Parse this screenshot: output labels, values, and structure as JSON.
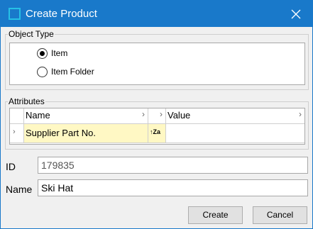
{
  "window": {
    "title": "Create Product"
  },
  "object_type": {
    "legend": "Object Type",
    "options": [
      {
        "label": "Item",
        "selected": true
      },
      {
        "label": "Item Folder",
        "selected": false
      }
    ]
  },
  "attributes": {
    "legend": "Attributes",
    "columns": [
      "Name",
      "Value"
    ],
    "rows": [
      {
        "name": "Supplier Part No.",
        "type_icon": "az-sort-icon",
        "value": ""
      }
    ]
  },
  "fields": {
    "id": {
      "label": "ID",
      "value": "179835"
    },
    "name": {
      "label": "Name",
      "value": "Ski Hat"
    }
  },
  "buttons": {
    "create": "Create",
    "cancel": "Cancel"
  },
  "colors": {
    "titlebar": "#1979ca",
    "selected_cell": "#fff8c4",
    "dialog_bg": "#f0f0f0"
  }
}
